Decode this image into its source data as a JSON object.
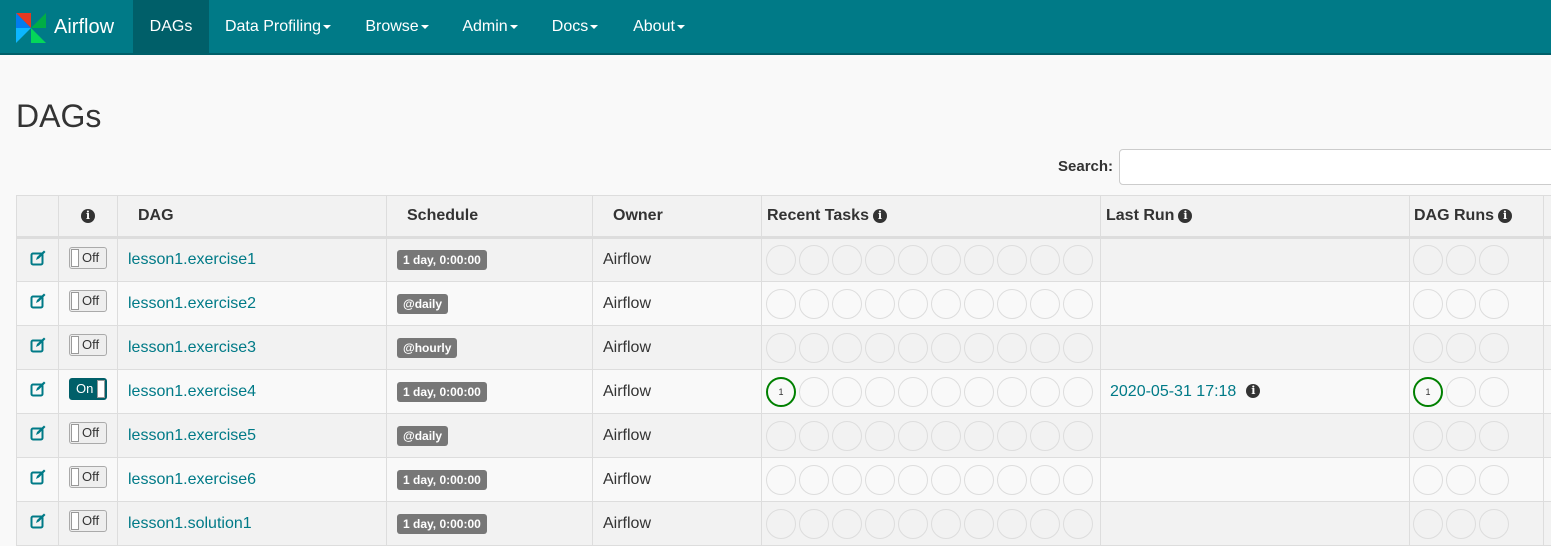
{
  "nav": {
    "brand": "Airflow",
    "items": [
      {
        "label": "DAGs",
        "active": true
      },
      {
        "label": "Data Profiling",
        "dropdown": true
      },
      {
        "label": "Browse",
        "dropdown": true
      },
      {
        "label": "Admin",
        "dropdown": true
      },
      {
        "label": "Docs",
        "dropdown": true
      },
      {
        "label": "About",
        "dropdown": true
      }
    ]
  },
  "page": {
    "title": "DAGs"
  },
  "search": {
    "label": "Search:",
    "value": ""
  },
  "table": {
    "headers": [
      "",
      "",
      "DAG",
      "Schedule",
      "Owner",
      "Recent Tasks",
      "Last Run",
      "DAG Runs"
    ],
    "rows": [
      {
        "toggle": "Off",
        "dag": "lesson1.exercise1",
        "schedule": "1 day, 0:00:00",
        "owner": "Airflow",
        "recent_tasks": [
          0,
          0,
          0,
          0,
          0,
          0,
          0,
          0,
          0,
          0
        ],
        "last_run": "",
        "dag_runs": [
          0,
          0,
          0
        ]
      },
      {
        "toggle": "Off",
        "dag": "lesson1.exercise2",
        "schedule": "@daily",
        "owner": "Airflow",
        "recent_tasks": [
          0,
          0,
          0,
          0,
          0,
          0,
          0,
          0,
          0,
          0
        ],
        "last_run": "",
        "dag_runs": [
          0,
          0,
          0
        ]
      },
      {
        "toggle": "Off",
        "dag": "lesson1.exercise3",
        "schedule": "@hourly",
        "owner": "Airflow",
        "recent_tasks": [
          0,
          0,
          0,
          0,
          0,
          0,
          0,
          0,
          0,
          0
        ],
        "last_run": "",
        "dag_runs": [
          0,
          0,
          0
        ]
      },
      {
        "toggle": "On",
        "dag": "lesson1.exercise4",
        "schedule": "1 day, 0:00:00",
        "owner": "Airflow",
        "recent_tasks": [
          1,
          0,
          0,
          0,
          0,
          0,
          0,
          0,
          0,
          0
        ],
        "last_run": "2020-05-31 17:18",
        "dag_runs": [
          1,
          0,
          0
        ]
      },
      {
        "toggle": "Off",
        "dag": "lesson1.exercise5",
        "schedule": "@daily",
        "owner": "Airflow",
        "recent_tasks": [
          0,
          0,
          0,
          0,
          0,
          0,
          0,
          0,
          0,
          0
        ],
        "last_run": "",
        "dag_runs": [
          0,
          0,
          0
        ]
      },
      {
        "toggle": "Off",
        "dag": "lesson1.exercise6",
        "schedule": "1 day, 0:00:00",
        "owner": "Airflow",
        "recent_tasks": [
          0,
          0,
          0,
          0,
          0,
          0,
          0,
          0,
          0,
          0
        ],
        "last_run": "",
        "dag_runs": [
          0,
          0,
          0
        ]
      },
      {
        "toggle": "Off",
        "dag": "lesson1.solution1",
        "schedule": "1 day, 0:00:00",
        "owner": "Airflow",
        "recent_tasks": [
          0,
          0,
          0,
          0,
          0,
          0,
          0,
          0,
          0,
          0
        ],
        "last_run": "",
        "dag_runs": [
          0,
          0,
          0
        ]
      }
    ]
  },
  "colors": {
    "navbar": "#007a87",
    "active_nav": "#005f69",
    "link": "#007a87",
    "success": "#008000",
    "label": "#777777"
  },
  "icons": {
    "edit": "edit-icon",
    "info": "info-icon",
    "logo": "pinwheel-logo-icon"
  }
}
